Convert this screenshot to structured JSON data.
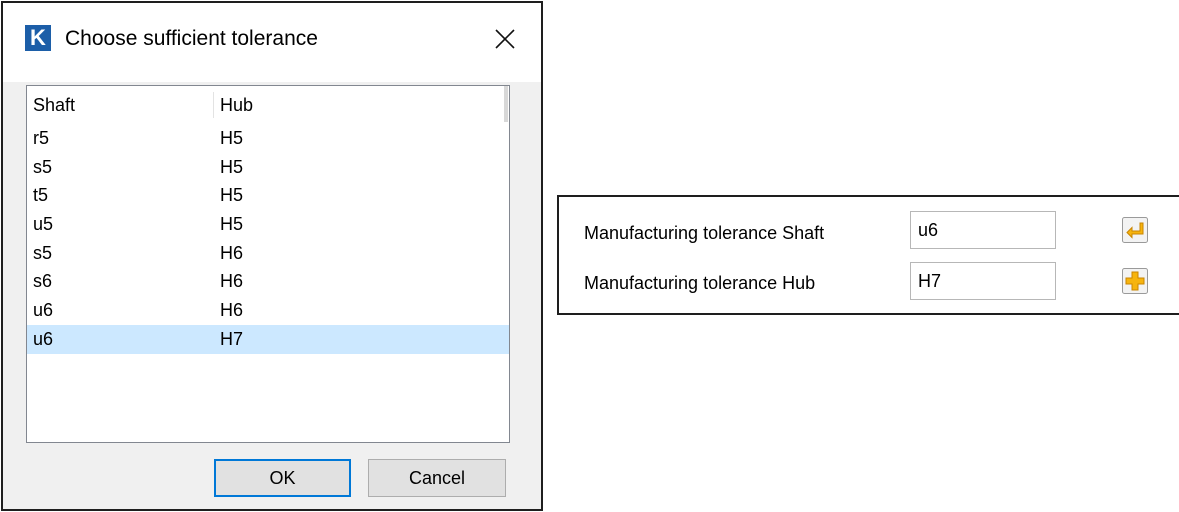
{
  "dialog": {
    "app_icon_letter": "K",
    "title": "Choose sufficient tolerance",
    "columns": {
      "shaft": "Shaft",
      "hub": "Hub"
    },
    "rows": [
      {
        "shaft": "r5",
        "hub": "H5"
      },
      {
        "shaft": "s5",
        "hub": "H5"
      },
      {
        "shaft": "t5",
        "hub": "H5"
      },
      {
        "shaft": "u5",
        "hub": "H5"
      },
      {
        "shaft": "s5",
        "hub": "H6"
      },
      {
        "shaft": "s6",
        "hub": "H6"
      },
      {
        "shaft": "u6",
        "hub": "H6"
      },
      {
        "shaft": "u6",
        "hub": "H7"
      }
    ],
    "selected_row_index": 7,
    "ok_label": "OK",
    "cancel_label": "Cancel"
  },
  "panel": {
    "shaft_label": "Manufacturing tolerance Shaft",
    "shaft_value": "u6",
    "shaft_icon": "arrow-return-icon",
    "hub_label": "Manufacturing tolerance Hub",
    "hub_value": "H7",
    "hub_icon": "plus-icon"
  },
  "colors": {
    "selection": "#cce8ff",
    "app_icon": "#1c5ea8",
    "ok_border": "#0078d7",
    "icon_button": "#f6b40e"
  }
}
